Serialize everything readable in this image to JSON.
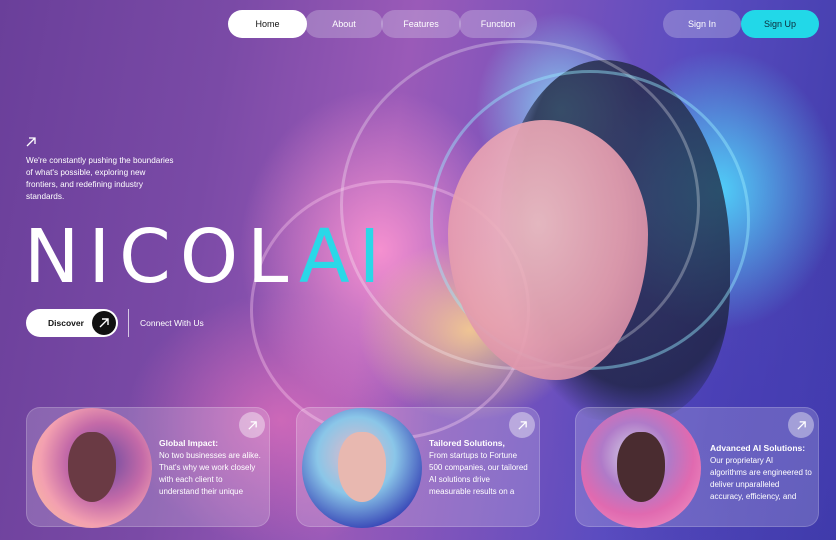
{
  "nav": {
    "items": [
      {
        "label": "Home",
        "active": true
      },
      {
        "label": "About",
        "active": false
      },
      {
        "label": "Features",
        "active": false
      },
      {
        "label": "Function",
        "active": false
      }
    ]
  },
  "auth": {
    "sign_in": "Sign In",
    "sign_up": "Sign Up"
  },
  "hero": {
    "arrow_icon": "arrow-up-right-icon",
    "tagline": "We're constantly pushing the boundaries of what's possible, exploring new frontiers, and redefining industry standards.",
    "brand_main": "NICOL",
    "brand_accent": "AI",
    "discover_label": "Discover",
    "connect_label": "Connect With Us"
  },
  "cards": [
    {
      "title": "Global Impact:",
      "description": "No two businesses are alike. That's why we work closely with each client to understand their unique",
      "icon": "arrow-up-right-icon"
    },
    {
      "title": "Tailored Solutions,",
      "description": "From startups to Fortune 500 companies, our tailored AI solutions drive measurable results on a",
      "icon": "arrow-up-right-icon"
    },
    {
      "title": "Advanced AI Solutions:",
      "description": "Our proprietary AI algorithms are engineered to deliver unparalleled accuracy, efficiency, and",
      "icon": "arrow-up-right-icon"
    }
  ],
  "colors": {
    "accent": "#2ad8e8",
    "signup_bg": "#22d8e8",
    "background": "#5a3f8e"
  }
}
